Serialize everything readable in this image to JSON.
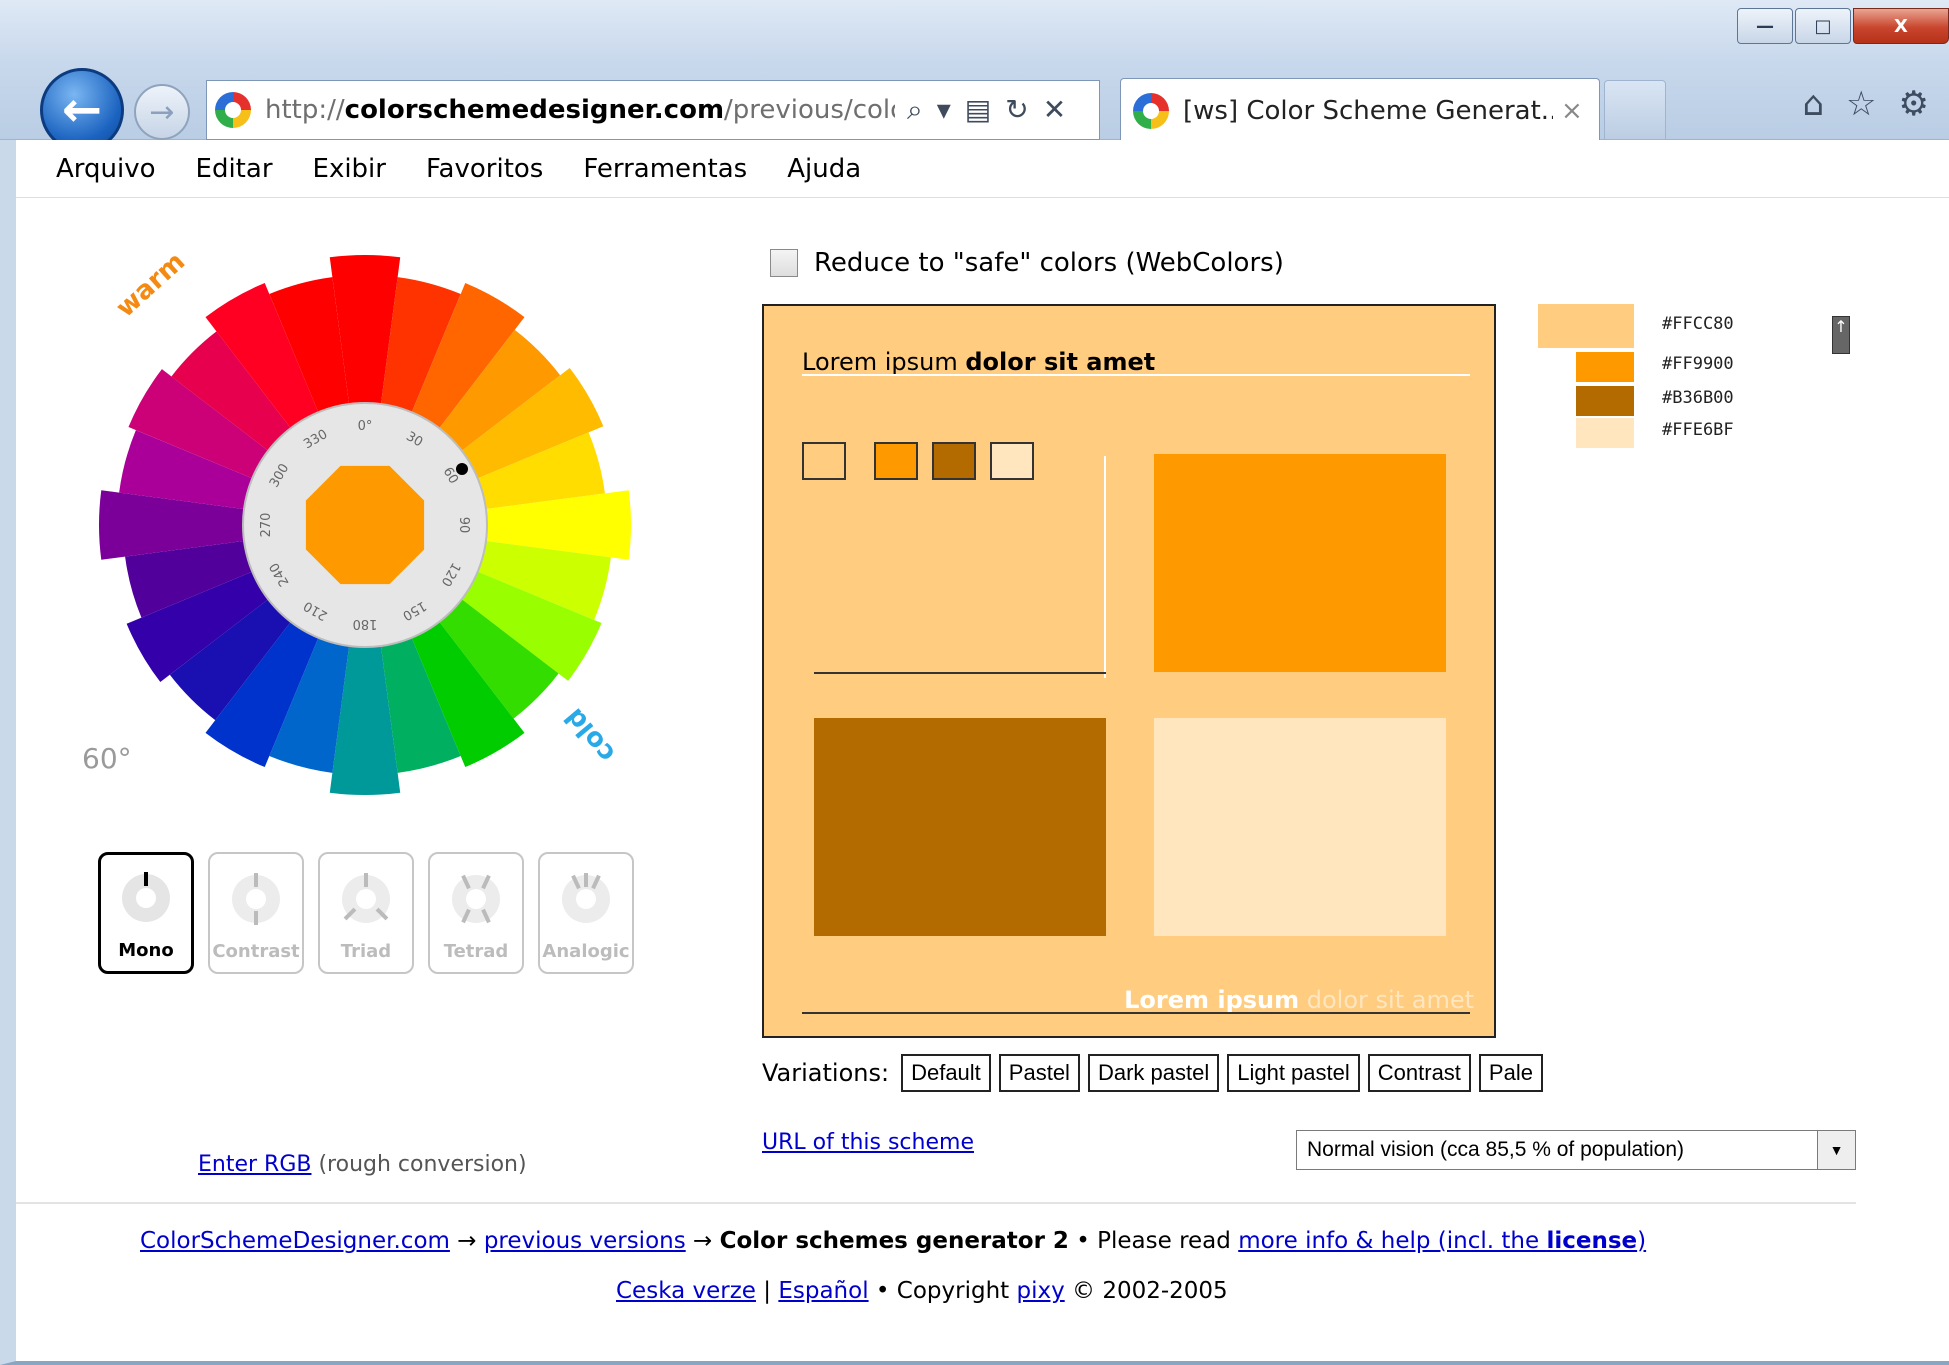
{
  "window": {
    "minimize_glyph": "—",
    "maximize_glyph": "□",
    "close_glyph": "X"
  },
  "browser": {
    "url_plain_prefix": "http://",
    "url_domain": "colorschemedesigner.com",
    "url_path": "/previous/color",
    "tab_title": "[ws] Color Scheme Generat...",
    "tab_close": "×",
    "back_glyph": "←",
    "forward_glyph": "→",
    "address_tools": [
      "search-icon",
      "dropdown-icon",
      "compat-icon",
      "refresh-icon",
      "stop-icon"
    ],
    "address_tool_glyphs": [
      "⌕",
      "▾",
      "▤",
      "↻",
      "✕"
    ],
    "nav_icon_glyphs": [
      "⌂",
      "☆",
      "⚙"
    ]
  },
  "menu": {
    "items": [
      "Arquivo",
      "Editar",
      "Exibir",
      "Favoritos",
      "Ferramentas",
      "Ajuda"
    ]
  },
  "wheel": {
    "warm_label": "warm",
    "cold_label": "cold",
    "degree_label": "60°",
    "hue_value": 60,
    "tick_labels": [
      "0°",
      "30",
      "60",
      "90",
      "120",
      "150",
      "180",
      "210",
      "240",
      "270",
      "300",
      "330"
    ],
    "segment_colors": [
      "#ff0000",
      "#ff3300",
      "#ff6600",
      "#ff9900",
      "#ffbb00",
      "#ffdd00",
      "#ffff00",
      "#ccff00",
      "#99ff00",
      "#33dd00",
      "#00cc00",
      "#00b060",
      "#009999",
      "#0066cc",
      "#0033cc",
      "#1a0fb0",
      "#3300aa",
      "#52009c",
      "#7a0099",
      "#aa0099",
      "#cc0077",
      "#e6004d",
      "#ff0022",
      "#ff0000"
    ],
    "center_color": "#ff9900"
  },
  "schemes": [
    {
      "label": "Mono",
      "active": true
    },
    {
      "label": "Contrast",
      "active": false
    },
    {
      "label": "Triad",
      "active": false
    },
    {
      "label": "Tetrad",
      "active": false
    },
    {
      "label": "Analogic",
      "active": false
    }
  ],
  "enter_rgb": {
    "link": "Enter RGB",
    "text": " (rough conversion)"
  },
  "safe_colors": {
    "label": "Reduce to \"safe\" colors (WebColors)",
    "checked": false
  },
  "preview": {
    "heading_plain": "Lorem ipsum ",
    "heading_bold": "dolor sit amet",
    "footer_bold": "Lorem ipsum",
    "footer_plain": " dolor sit amet",
    "background": "#ffcc80",
    "chips": [
      "#ffcc80",
      "#ff9900",
      "#b36b00",
      "#ffe6bf"
    ],
    "boxes": [
      "#ff9900",
      "#b36b00",
      "#ffe6bf"
    ]
  },
  "palette": [
    {
      "hex": "#FFCC80",
      "color": "#ffcc80"
    },
    {
      "hex": "#FF9900",
      "color": "#ff9900"
    },
    {
      "hex": "#B36B00",
      "color": "#b36b00"
    },
    {
      "hex": "#FFE6BF",
      "color": "#ffe6bf"
    }
  ],
  "variations": {
    "label": "Variations:",
    "options": [
      "Default",
      "Pastel",
      "Dark pastel",
      "Light pastel",
      "Contrast",
      "Pale"
    ]
  },
  "url_of_scheme": "URL of this scheme",
  "vision_select": {
    "value": "Normal vision (cca 85,5 % of population)"
  },
  "footer": {
    "line1": {
      "link1": "ColorSchemeDesigner.com",
      "arrow1": " → ",
      "link2": "previous versions",
      "arrow2": " → ",
      "bold": "Color schemes generator 2",
      "middle": " • Please read ",
      "link3_plain": "more info & help (incl. the ",
      "link3_bold": "license",
      "link3_close": ")"
    },
    "line2": {
      "link1": "Ceska verze",
      "sep": " | ",
      "link2": "Español",
      "middle": " • Copyright ",
      "link3": "pixy",
      "end": " © 2002-2005"
    }
  }
}
